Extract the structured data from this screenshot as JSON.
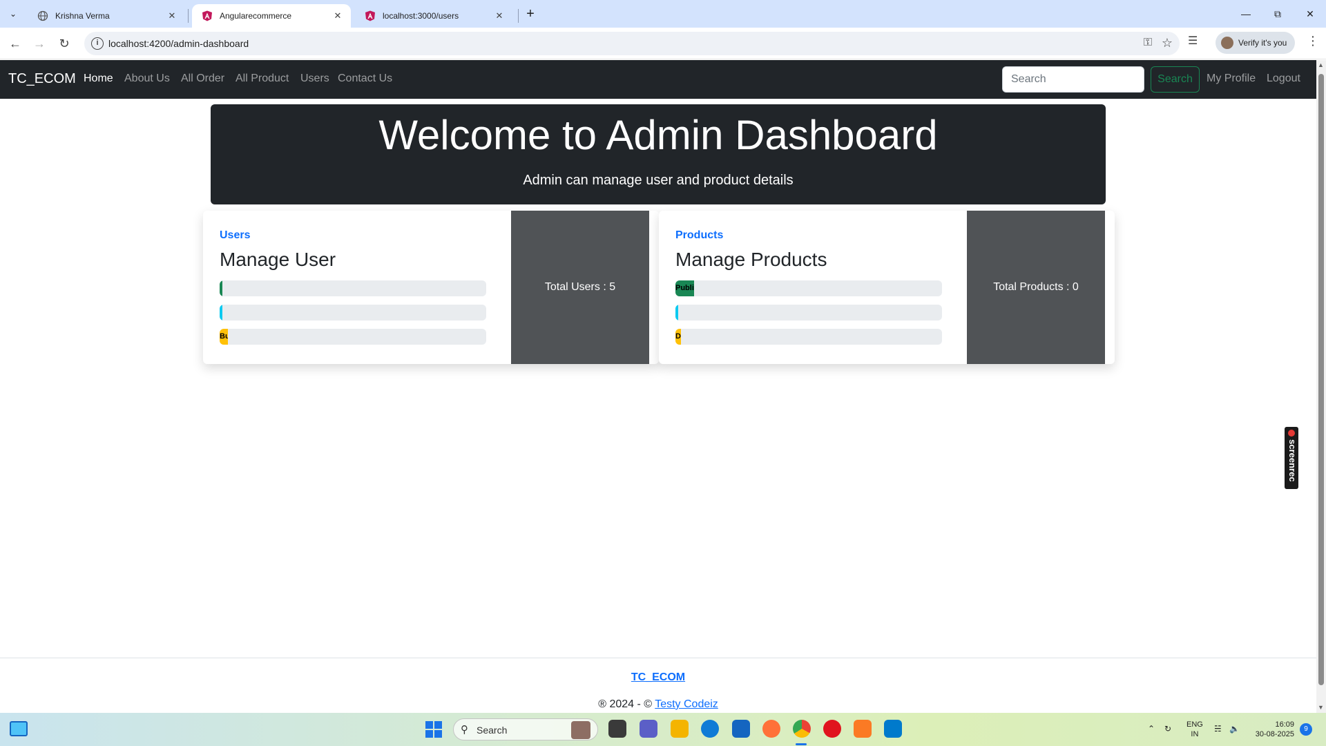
{
  "browser": {
    "tabs": [
      {
        "title": "Krishna Verma"
      },
      {
        "title": "Angularecommerce"
      },
      {
        "title": "localhost:3000/users"
      }
    ],
    "new_tab": "+",
    "url": "localhost:4200/admin-dashboard",
    "profile_label": "Verify it's you"
  },
  "navbar": {
    "brand": "TC_ECOM",
    "links": [
      "Home",
      "About Us",
      "All Order",
      "All Product",
      "Users",
      "Contact Us"
    ],
    "search_placeholder": "Search",
    "search_button": "Search",
    "my_profile": "My Profile",
    "logout": "Logout"
  },
  "hero": {
    "title": "Welcome to Admin Dashboard",
    "subtitle": "Admin can manage user and product details"
  },
  "cards": [
    {
      "subtitle": "Users",
      "title": "Manage User",
      "total": "Total Users : 5",
      "bars": [
        {
          "label": "",
          "percent": 1,
          "color": "#198754"
        },
        {
          "label": "",
          "percent": 1,
          "color": "#0dcaf0"
        },
        {
          "label": "Bu",
          "percent": 3,
          "color": "#ffc107"
        }
      ]
    },
    {
      "subtitle": "Products",
      "title": "Manage Products",
      "total": "Total Products : 0",
      "bars": [
        {
          "label": "Publi",
          "percent": 7,
          "color": "#198754"
        },
        {
          "label": "",
          "percent": 1,
          "color": "#0dcaf0"
        },
        {
          "label": "D",
          "percent": 2,
          "color": "#ffc107"
        }
      ]
    }
  ],
  "footer": {
    "brand": "TC_ECOM",
    "copy_prefix": "® 2024 - ©",
    "copy_link": "Testy Codeiz"
  },
  "overlay": {
    "screenrec": "screenrec"
  },
  "taskbar": {
    "search": "Search",
    "lang_top": "ENG",
    "lang_bottom": "IN",
    "time": "16:09",
    "date": "30-08-2025",
    "notifications": "9"
  }
}
